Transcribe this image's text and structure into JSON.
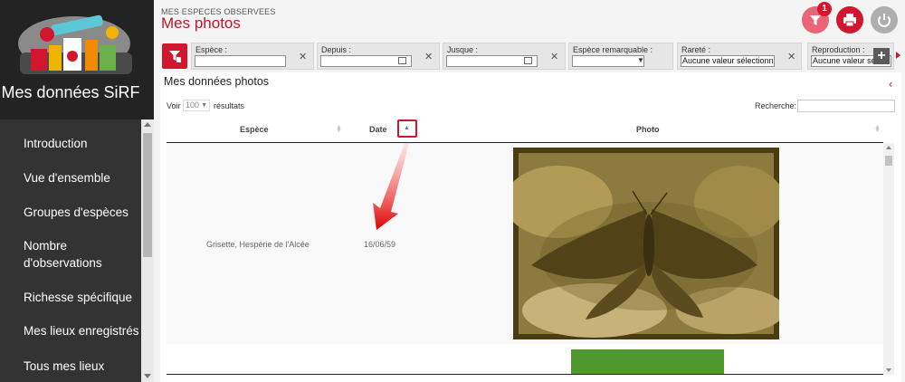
{
  "sidebar": {
    "title": "Mes données SiRF",
    "items": [
      {
        "label": "Introduction"
      },
      {
        "label": "Vue d'ensemble"
      },
      {
        "label": "Groupes d'espèces"
      },
      {
        "label": "Nombre d'observations"
      },
      {
        "label": "Richesse spécifique"
      },
      {
        "label": "Mes lieux enregistrés"
      },
      {
        "label": "Tous mes lieux"
      }
    ]
  },
  "header": {
    "breadcrumb": "MES ESPECES OBSERVEES",
    "title": "Mes photos",
    "filter_badge": "1",
    "buttons": [
      {
        "name": "filter",
        "icon": "filter-icon"
      },
      {
        "name": "print",
        "icon": "printer-icon"
      },
      {
        "name": "logout",
        "icon": "power-icon"
      }
    ]
  },
  "filters": [
    {
      "label": "Espèce :",
      "value": "",
      "type": "text"
    },
    {
      "label": "Depuis :",
      "value": "",
      "type": "date"
    },
    {
      "label": "Jusque :",
      "value": "",
      "type": "date"
    },
    {
      "label": "Espèce remarquable :",
      "value": "",
      "type": "select"
    },
    {
      "label": "Rareté :",
      "value": "Aucune valeur sélectionnée",
      "type": "multiselect"
    },
    {
      "label": "Reproduction :",
      "value": "Aucune valeur sélectionnée",
      "type": "multiselect"
    }
  ],
  "panel": {
    "title": "Mes données photos",
    "show_label": "Voir",
    "show_value": "100",
    "show_suffix": "résultats",
    "search_label": "Recherche:",
    "search_value": ""
  },
  "table": {
    "columns": [
      "Espèce",
      "Date",
      "Photo"
    ],
    "sorted_column": "Date",
    "sort_direction": "ascending",
    "rows": [
      {
        "species": "Grisette, Hespérie de l'Alcée",
        "date": "16/06/59",
        "photo": "sepia-butterfly-photo"
      },
      {
        "species": "",
        "date": "",
        "photo": "green-leaf-photo"
      }
    ]
  },
  "colors": {
    "accent": "#d2162d",
    "sidebar_bg": "#333333",
    "sidebar_head_bg": "#232323",
    "filter_badge_bg": "#ea6576",
    "power_bg": "#aeaeae"
  }
}
